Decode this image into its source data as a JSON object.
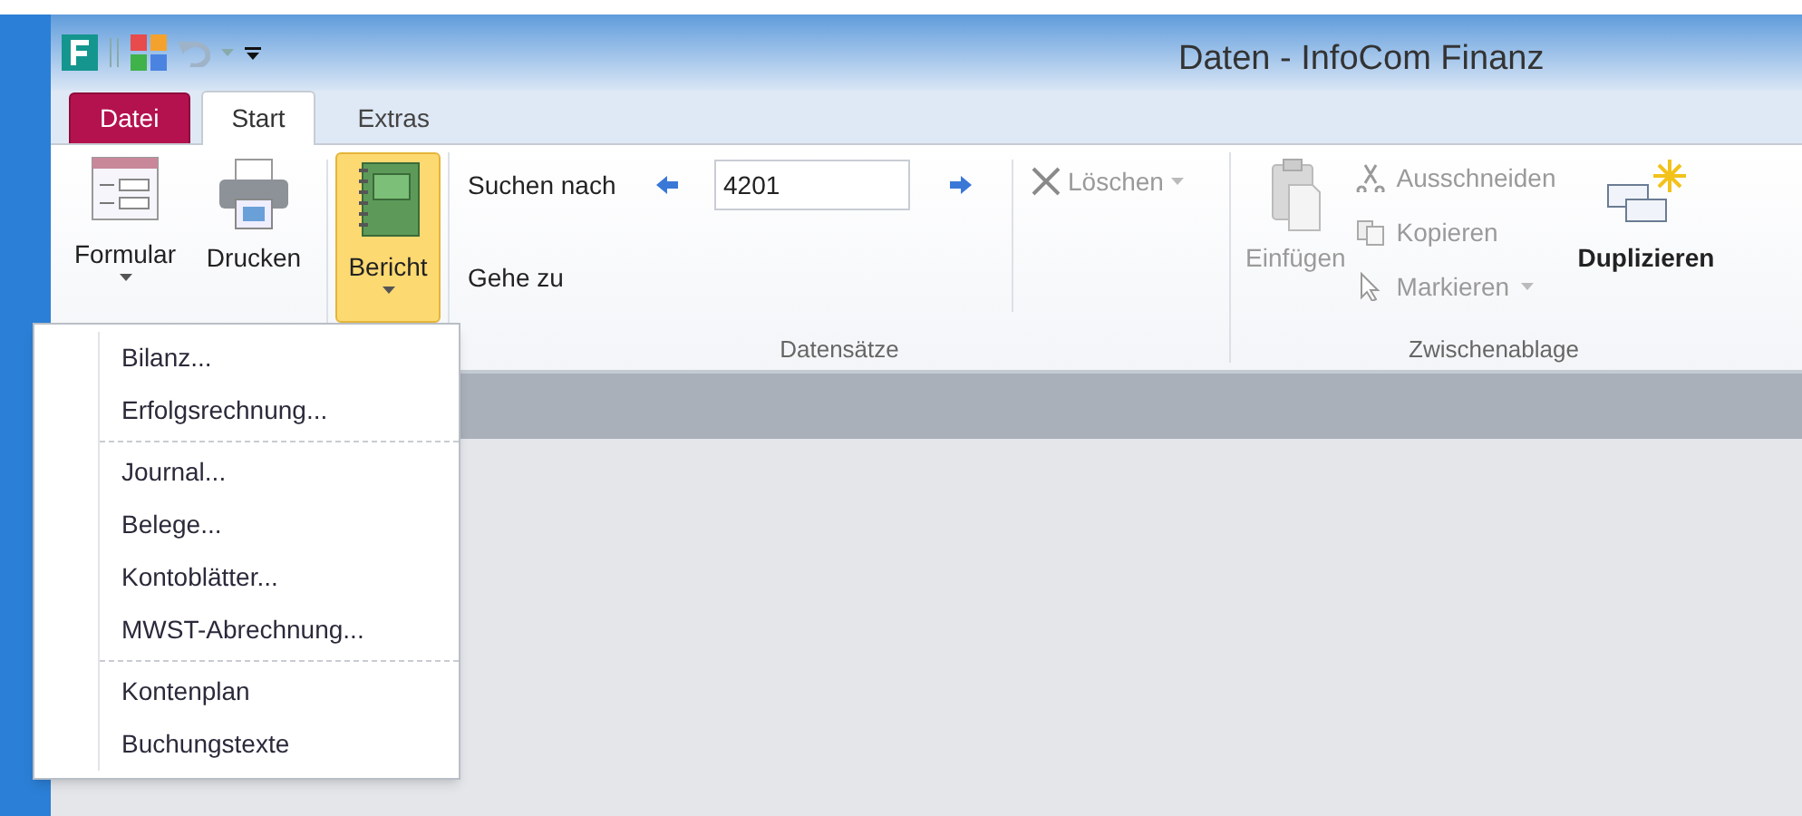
{
  "window": {
    "title": "Daten - InfoCom Finanz"
  },
  "tabs": [
    {
      "label": "Datei",
      "kind": "file",
      "selected": false
    },
    {
      "label": "Start",
      "kind": "tab",
      "selected": true
    },
    {
      "label": "Extras",
      "kind": "tab",
      "selected": false
    }
  ],
  "ribbon": {
    "formular": {
      "label": "Formular"
    },
    "drucken": {
      "label": "Drucken"
    },
    "bericht": {
      "label": "Bericht",
      "pressed": true
    },
    "records": {
      "label": "Datensätze",
      "search_label": "Suchen nach",
      "search_value": "4201",
      "goto_label": "Gehe zu",
      "delete": {
        "label": "Löschen",
        "disabled": true
      }
    },
    "clipboard": {
      "label": "Zwischenablage",
      "paste": {
        "label": "Einfügen",
        "disabled": true
      },
      "cut": {
        "label": "Ausschneiden",
        "disabled": true
      },
      "copy": {
        "label": "Kopieren",
        "disabled": true
      },
      "select": {
        "label": "Markieren",
        "disabled": true
      },
      "duplicate": {
        "label": "Duplizieren",
        "disabled": false
      }
    }
  },
  "menu": {
    "sections": [
      {
        "items": [
          {
            "label": "Bilanz..."
          },
          {
            "label": "Erfolgsrechnung..."
          }
        ]
      },
      {
        "items": [
          {
            "label": "Journal..."
          },
          {
            "label": "Belege..."
          },
          {
            "label": "Kontoblätter..."
          },
          {
            "label": "MWST-Abrechnung..."
          }
        ]
      },
      {
        "items": [
          {
            "label": "Kontenplan"
          },
          {
            "label": "Buchungstexte"
          }
        ]
      }
    ]
  }
}
